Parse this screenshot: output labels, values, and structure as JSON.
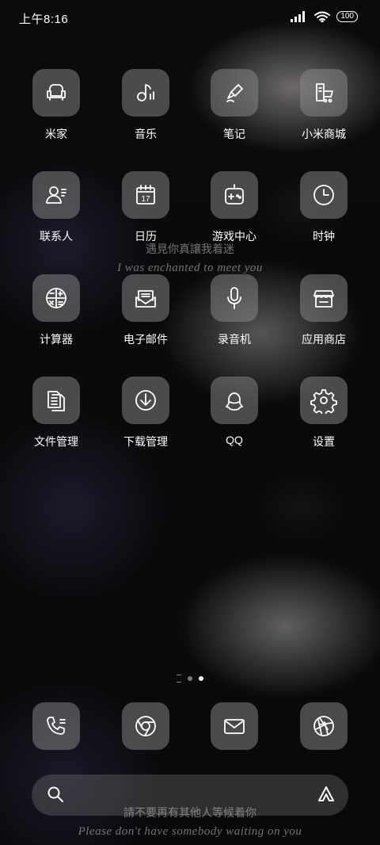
{
  "status": {
    "time": "上午8:16",
    "battery": "100"
  },
  "apps": [
    {
      "label": "米家",
      "icon": "sofa-icon"
    },
    {
      "label": "音乐",
      "icon": "music-note-icon"
    },
    {
      "label": "笔记",
      "icon": "pen-icon"
    },
    {
      "label": "小米商城",
      "icon": "shopping-cart-icon"
    },
    {
      "label": "联系人",
      "icon": "contact-icon"
    },
    {
      "label": "日历",
      "icon": "calendar-icon",
      "day": "17"
    },
    {
      "label": "游戏中心",
      "icon": "gamepad-icon"
    },
    {
      "label": "时钟",
      "icon": "clock-icon"
    },
    {
      "label": "计算器",
      "icon": "calculator-icon"
    },
    {
      "label": "电子邮件",
      "icon": "email-icon"
    },
    {
      "label": "录音机",
      "icon": "microphone-icon"
    },
    {
      "label": "应用商店",
      "icon": "store-icon"
    },
    {
      "label": "文件管理",
      "icon": "files-icon"
    },
    {
      "label": "下载管理",
      "icon": "download-icon"
    },
    {
      "label": "QQ",
      "icon": "qq-penguin-icon"
    },
    {
      "label": "设置",
      "icon": "gear-icon"
    }
  ],
  "lyrics": {
    "top_zh": "遇見你真讓我着迷",
    "top_en": "I was enchanted to meet you",
    "bottom_zh": "請不要再有其他人等候着你",
    "bottom_en": "Please don't have somebody waiting on you"
  },
  "dock": [
    {
      "icon": "phone-icon"
    },
    {
      "icon": "chrome-browser-icon"
    },
    {
      "icon": "mail-icon"
    },
    {
      "icon": "camera-aperture-icon"
    }
  ],
  "search": {
    "left_icon": "search-icon",
    "right_icon": "assistant-icon"
  }
}
